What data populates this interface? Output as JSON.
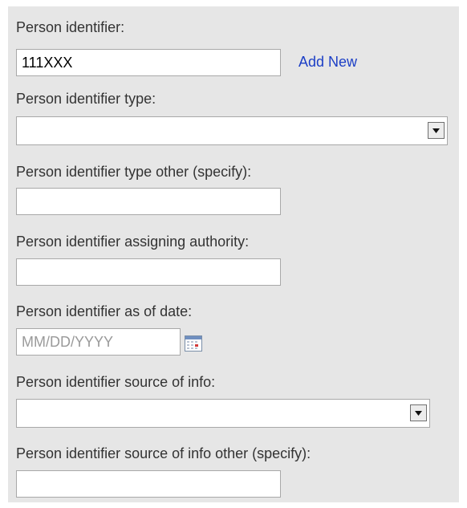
{
  "form": {
    "identifier": {
      "label": "Person identifier:",
      "value": "111XXX",
      "add_link": "Add New"
    },
    "identifier_type": {
      "label": "Person identifier type:",
      "selected": ""
    },
    "identifier_type_other": {
      "label": "Person identifier type other (specify):",
      "value": ""
    },
    "assigning_authority": {
      "label": "Person identifier assigning authority:",
      "value": ""
    },
    "as_of_date": {
      "label": "Person identifier as of date:",
      "placeholder": "MM/DD/YYYY",
      "icon": "calendar-icon"
    },
    "source_of_info": {
      "label": "Person identifier source of info:",
      "selected": ""
    },
    "source_of_info_other": {
      "label": "Person identifier source of info other (specify):",
      "value": ""
    }
  },
  "colors": {
    "panel_bg": "#e6e6e6",
    "label_text": "#333333",
    "link": "#1c3fc6",
    "field_border": "#a8a8a8"
  }
}
